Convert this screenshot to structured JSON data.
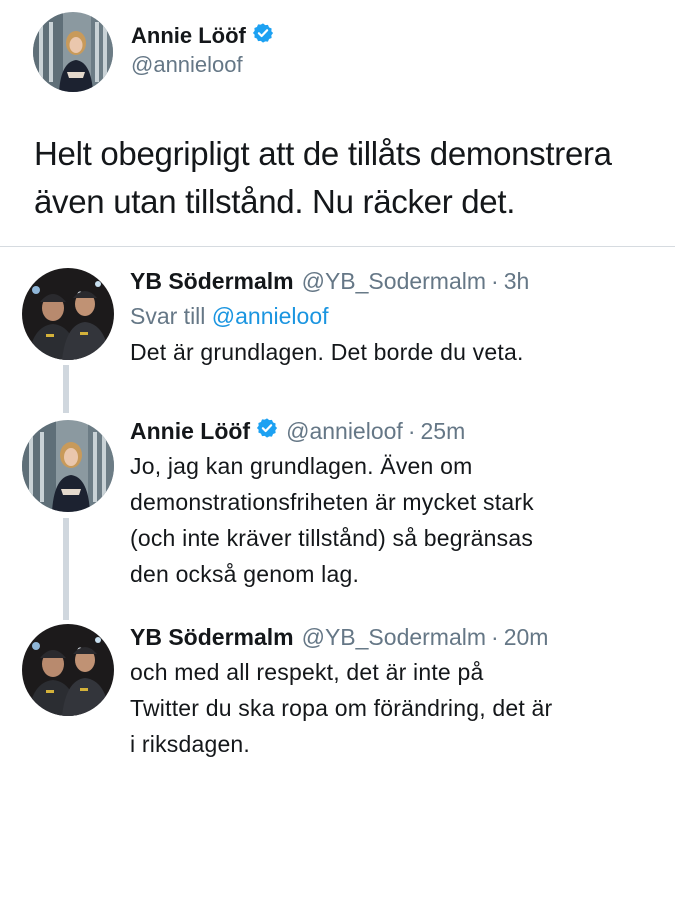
{
  "main_tweet": {
    "author_name": "Annie Lööf",
    "author_handle": "@annieloof",
    "verified": true,
    "text_line1": "Helt obegripligt att de tillåts demonstrera",
    "text_line2": "även utan tillstånd. Nu räcker det."
  },
  "replies": [
    {
      "author_name": "YB Södermalm",
      "author_handle": "@YB_Sodermalm",
      "separator": "·",
      "time": "3h",
      "reply_to_prefix": "Svar till",
      "reply_to_handle": "@annieloof",
      "text_lines": [
        "Det är grundlagen. Det borde du veta."
      ]
    },
    {
      "author_name": "Annie Lööf",
      "author_handle": "@annieloof",
      "verified": true,
      "separator": "·",
      "time": "25m",
      "text_lines": [
        "Jo, jag kan grundlagen. Även om",
        "demonstrationsfriheten är mycket stark",
        "(och inte kräver tillstånd) så begränsas",
        "den också genom lag."
      ]
    },
    {
      "author_name": "YB Södermalm",
      "author_handle": "@YB_Sodermalm",
      "separator": "·",
      "time": "20m",
      "text_lines": [
        "och med all respekt, det är inte på",
        "Twitter du ska ropa om förändring, det är",
        "i riksdagen."
      ]
    }
  ],
  "colors": {
    "text": "#14171a",
    "secondary": "#657786",
    "link": "#1b95e0",
    "verified": "#1da1f2",
    "thread_line": "#d0d7de"
  }
}
